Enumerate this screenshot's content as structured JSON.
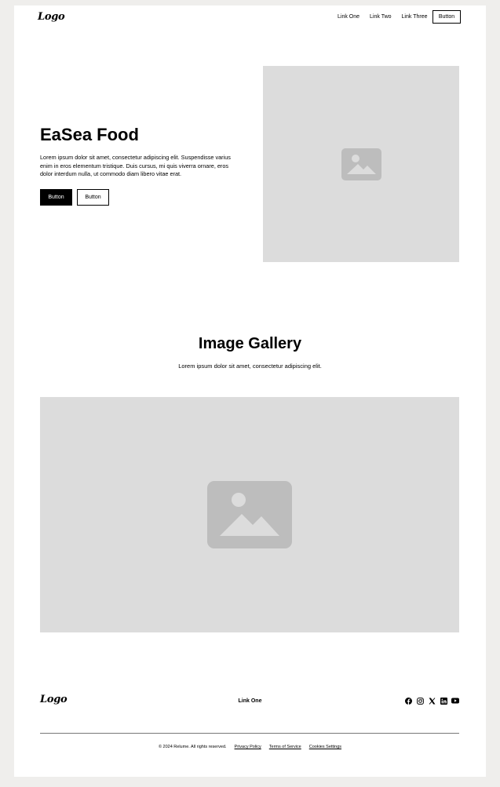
{
  "navbar": {
    "logo": "Logo",
    "links": [
      "Link One",
      "Link Two",
      "Link Three"
    ],
    "button_label": "Button"
  },
  "hero": {
    "title": "EaSea Food",
    "text": "Lorem ipsum dolor sit amet, consectetur adipiscing elit. Suspendisse varius enim in eros elementum tristique. Duis cursus, mi quis viverra ornare, eros dolor interdum nulla, ut commodo diam libero vitae erat.",
    "primary_button": "Button",
    "secondary_button": "Button",
    "image_icon": "image-placeholder-icon"
  },
  "gallery": {
    "title": "Image Gallery",
    "subtitle": "Lorem ipsum dolor sit amet, consectetur adipiscing elit.",
    "image_icon": "image-placeholder-icon"
  },
  "footer": {
    "logo": "Logo",
    "link": "Link One",
    "socials": [
      "facebook-icon",
      "instagram-icon",
      "x-icon",
      "linkedin-icon",
      "youtube-icon"
    ],
    "copyright": "© 2024 Relume. All rights reserved.",
    "legal_links": [
      "Privacy Policy",
      "Terms of Service",
      "Cookies Settings"
    ]
  },
  "colors": {
    "background": "#efeeec",
    "page": "#ffffff",
    "placeholder": "#dcdcdc",
    "placeholder_icon": "#bdbdbd",
    "text": "#000000"
  }
}
